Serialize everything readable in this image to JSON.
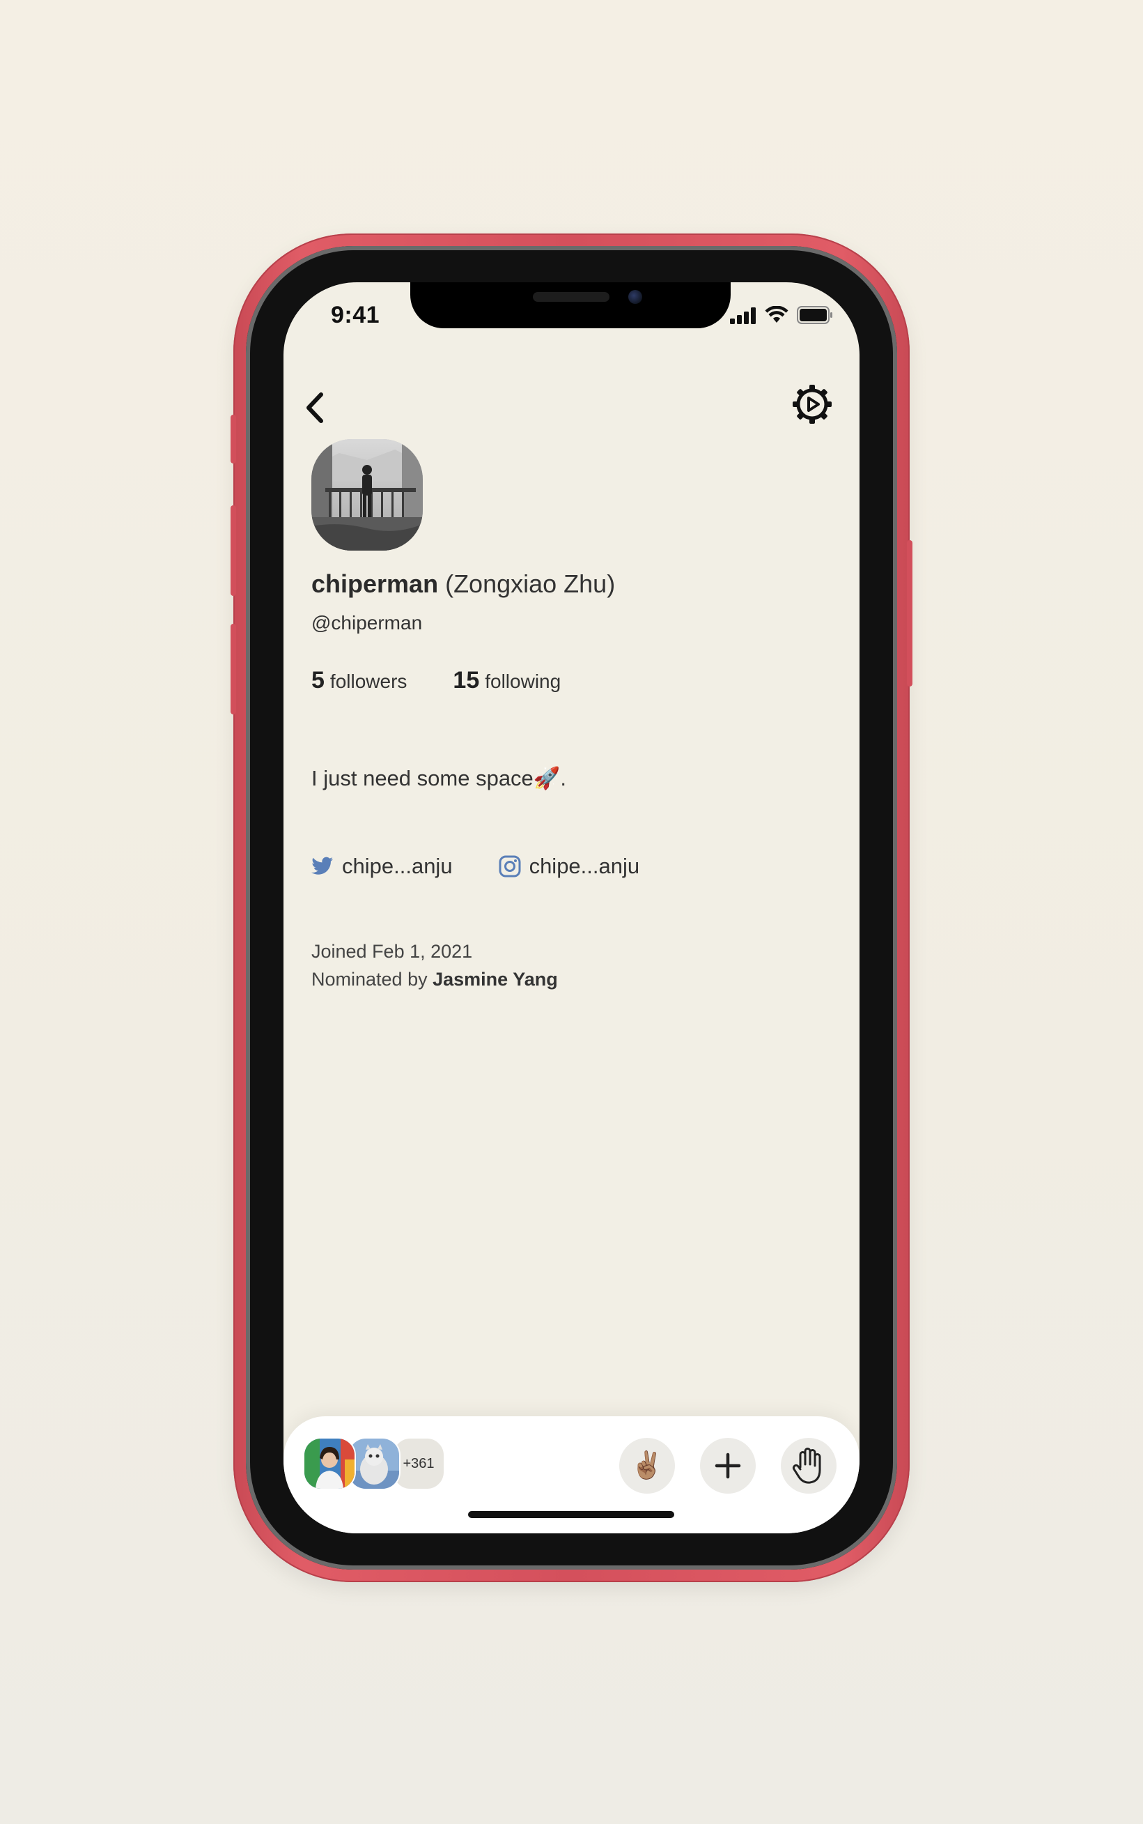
{
  "status_bar": {
    "time": "9:41"
  },
  "profile": {
    "username": "chiperman",
    "real_name": "(Zongxiao Zhu)",
    "handle": "@chiperman",
    "followers_count": "5",
    "followers_label": "followers",
    "following_count": "15",
    "following_label": "following",
    "bio": "I just need some space🚀.",
    "twitter": "chipe...anju",
    "instagram": "chipe...anju",
    "joined": "Joined Feb 1, 2021",
    "nominated_prefix": "Nominated by",
    "nominator": "Jasmine Yang"
  },
  "bottom_bar": {
    "extra_count": "+361",
    "peace_emoji": "✌🏽"
  },
  "colors": {
    "background": "#f2efe5",
    "phone_frame": "#d4505c",
    "twitter_blue": "#5a7fb8",
    "instagram_blue": "#5a7fb8"
  },
  "icons": {
    "back": "chevron-left-icon",
    "settings": "gear-icon",
    "twitter": "twitter-bird-icon",
    "instagram": "instagram-icon",
    "add": "plus-icon",
    "raise_hand": "hand-icon"
  }
}
